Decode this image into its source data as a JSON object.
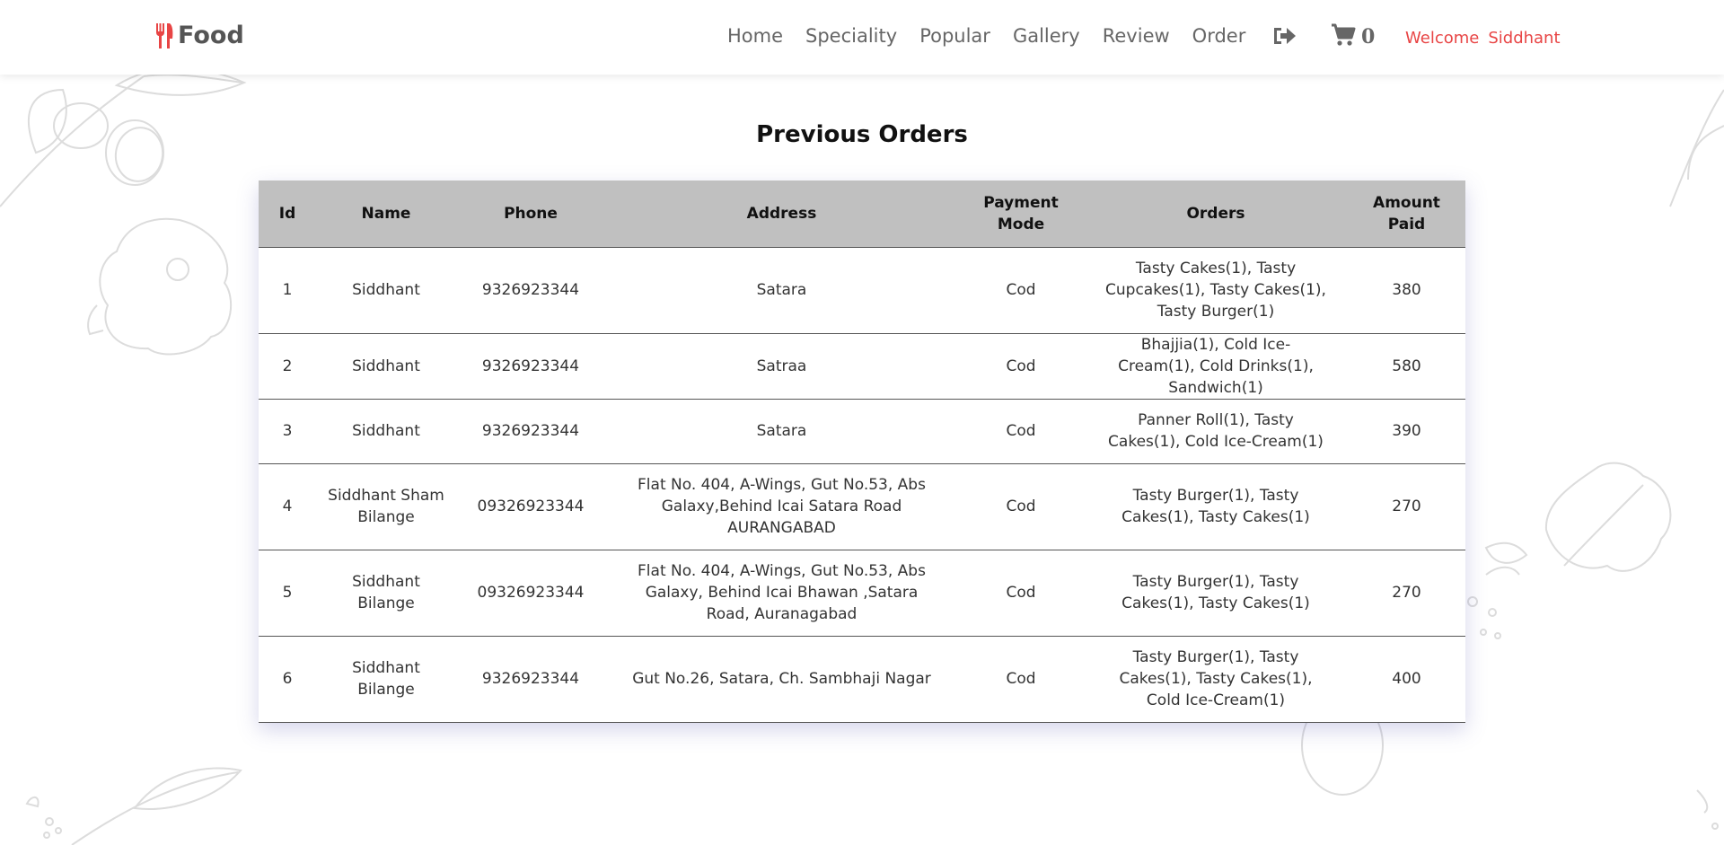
{
  "brand": {
    "name": "Food",
    "icon": "utensils-icon",
    "color": "#e84545"
  },
  "nav": {
    "links": [
      {
        "label": "Home"
      },
      {
        "label": "Speciality"
      },
      {
        "label": "Popular"
      },
      {
        "label": "Gallery"
      },
      {
        "label": "Review"
      },
      {
        "label": "Order"
      }
    ],
    "logout_icon": "sign-out-icon",
    "cart": {
      "icon": "cart-icon",
      "count": "0"
    },
    "welcome": {
      "prefix": "Welcome",
      "user": "Siddhant",
      "color": "#e84545"
    }
  },
  "page": {
    "title": "Previous Orders",
    "table": {
      "headers": {
        "id": "Id",
        "name": "Name",
        "phone": "Phone",
        "address": "Address",
        "payment": "Payment Mode",
        "orders": "Orders",
        "amount": "Amount Paid"
      },
      "header_bg": "#c0c0c0",
      "rows": [
        {
          "id": "1",
          "name": "Siddhant",
          "phone": "9326923344",
          "address": "Satara",
          "payment": "Cod",
          "orders": "Tasty Cakes(1), Tasty Cupcakes(1), Tasty Cakes(1), Tasty Burger(1)",
          "amount": "380"
        },
        {
          "id": "2",
          "name": "Siddhant",
          "phone": "9326923344",
          "address": "Satraa",
          "payment": "Cod",
          "orders": "Bhajjia(1), Cold Ice-Cream(1), Cold Drinks(1), Sandwich(1)",
          "amount": "580"
        },
        {
          "id": "3",
          "name": "Siddhant",
          "phone": "9326923344",
          "address": "Satara",
          "payment": "Cod",
          "orders": "Panner Roll(1), Tasty Cakes(1), Cold Ice-Cream(1)",
          "amount": "390"
        },
        {
          "id": "4",
          "name": "Siddhant Sham Bilange",
          "phone": "09326923344",
          "address": "Flat No. 404, A-Wings, Gut No.53, Abs Galaxy,Behind Icai Satara Road AURANGABAD",
          "payment": "Cod",
          "orders": "Tasty Burger(1), Tasty Cakes(1), Tasty Cakes(1)",
          "amount": "270"
        },
        {
          "id": "5",
          "name": "Siddhant Bilange",
          "phone": "09326923344",
          "address": "Flat No. 404, A-Wings, Gut No.53, Abs Galaxy, Behind Icai Bhawan ,Satara Road, Auranagabad",
          "payment": "Cod",
          "orders": "Tasty Burger(1), Tasty Cakes(1), Tasty Cakes(1)",
          "amount": "270"
        },
        {
          "id": "6",
          "name": "Siddhant Bilange",
          "phone": "9326923344",
          "address": "Gut No.26, Satara, Ch. Sambhaji Nagar",
          "payment": "Cod",
          "orders": "Tasty Burger(1), Tasty Cakes(1), Tasty Cakes(1), Cold Ice-Cream(1)",
          "amount": "400"
        }
      ]
    }
  }
}
